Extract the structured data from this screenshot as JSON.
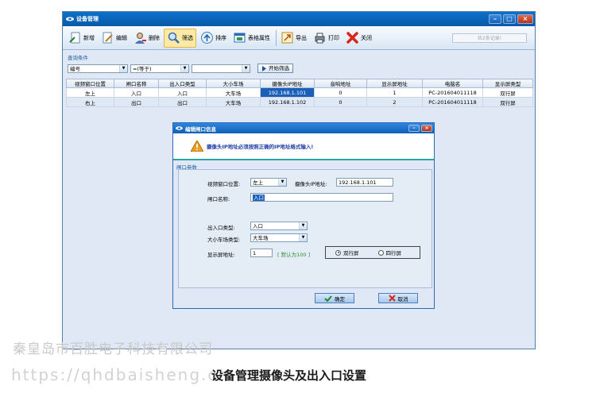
{
  "window": {
    "title": "设备管理"
  },
  "toolbar": {
    "buttons": [
      {
        "key": "new",
        "label": "新增"
      },
      {
        "key": "edit",
        "label": "编辑"
      },
      {
        "key": "delete",
        "label": "删除"
      },
      {
        "key": "filter",
        "label": "筛选"
      },
      {
        "key": "sort",
        "label": "排序"
      },
      {
        "key": "table_props",
        "label": "表格属性"
      },
      {
        "key": "export",
        "label": "导出"
      },
      {
        "key": "print",
        "label": "打印"
      },
      {
        "key": "close",
        "label": "关闭"
      }
    ],
    "record_count": "共2条记录!"
  },
  "query": {
    "title": "查询条件",
    "field": "编号",
    "operator": "=(等于)",
    "value": "",
    "start_button": "开始筛选"
  },
  "grid": {
    "columns": [
      "视频窗口位置",
      "闸口名称",
      "出入口类型",
      "大小车场",
      "摄像头IP地址",
      "音响地址",
      "显示屏地址",
      "电脑名",
      "显示屏类型"
    ],
    "rows": [
      [
        "左上",
        "入口",
        "入口",
        "大车场",
        "192.168.1.101",
        "0",
        "1",
        "PC-201604011118",
        "双行屏"
      ],
      [
        "右上",
        "出口",
        "出口",
        "大车场",
        "192.168.1.102",
        "0",
        "2",
        "PC-201604011118",
        "双行屏"
      ]
    ]
  },
  "dialog": {
    "title": "编辑闸口信息",
    "warning": "摄像头IP地址必须按照正确的IP地址格式输入!",
    "section_title": "闸口参数",
    "video_pos_label": "视频窗口位置:",
    "video_pos_value": "左上",
    "ip_label": "摄像头IP地址:",
    "ip_value": "192.168.1.101",
    "gate_name_label": "闸口名称:",
    "gate_name_value": "入口",
    "io_type_label": "出入口类型:",
    "io_type_value": "入口",
    "lot_type_label": "大小车场类型:",
    "lot_type_value": "大车场",
    "screen_addr_label": "显示屏地址:",
    "screen_addr_value": "1",
    "screen_addr_hint": "[ 默认为100 ]",
    "radio_double": "双行屏",
    "radio_quad": "四行屏",
    "confirm_button": "确定",
    "cancel_button": "取消"
  },
  "watermark": {
    "company": "秦皇岛市百胜电子科技有限公司",
    "url": "https://qhdbaisheng.cn"
  },
  "caption": "设备管理摄像头及出入口设置",
  "colors": {
    "title_bar": "#0d71c9",
    "accent_teal": "#29a6a0",
    "selection": "#1c5fb6"
  }
}
